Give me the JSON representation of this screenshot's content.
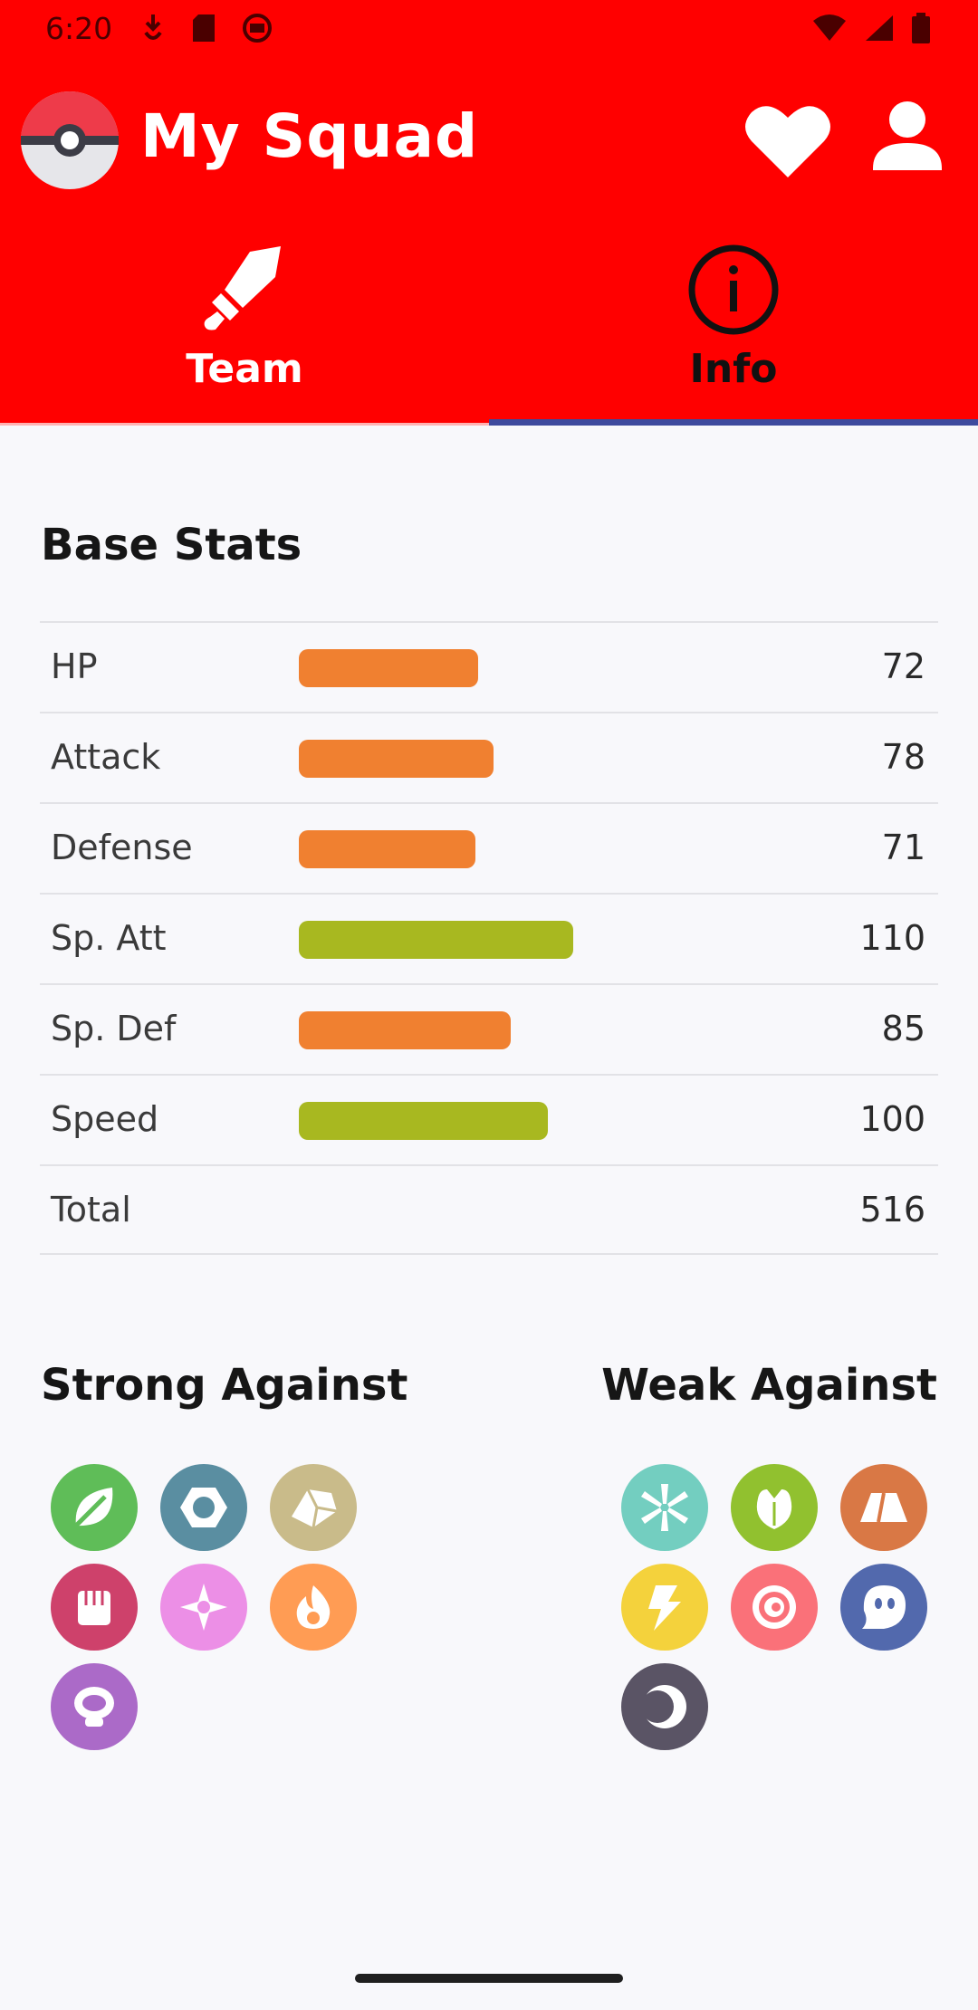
{
  "status_bar": {
    "time": "6:20"
  },
  "app_bar": {
    "title": "My Squad"
  },
  "tabs": [
    {
      "label": "Team",
      "icon": "sword-icon",
      "selected": false
    },
    {
      "label": "Info",
      "icon": "info-icon",
      "selected": true
    }
  ],
  "base_stats": {
    "title": "Base Stats",
    "max_value": 150,
    "rows": [
      {
        "name": "HP",
        "value": "72",
        "level": 72,
        "color": "#f08030"
      },
      {
        "name": "Attack",
        "value": "78",
        "level": 78,
        "color": "#f08030"
      },
      {
        "name": "Defense",
        "value": "71",
        "level": 71,
        "color": "#f08030"
      },
      {
        "name": "Sp. Att",
        "value": "110",
        "level": 110,
        "color": "#a8b820"
      },
      {
        "name": "Sp. Def",
        "value": "85",
        "level": 85,
        "color": "#f08030"
      },
      {
        "name": "Speed",
        "value": "100",
        "level": 100,
        "color": "#a8b820"
      }
    ],
    "total": {
      "name": "Total",
      "value": "516"
    }
  },
  "strong_against": {
    "title": "Strong Against",
    "types": [
      {
        "icon": "grass-type-icon",
        "color": "#5fbd58"
      },
      {
        "icon": "steel-type-icon",
        "color": "#5a8ea1"
      },
      {
        "icon": "rock-type-icon",
        "color": "#c9bb8a"
      },
      {
        "icon": "fighting-type-icon",
        "color": "#ce416b"
      },
      {
        "icon": "fairy-type-icon",
        "color": "#ec8fe6"
      },
      {
        "icon": "fire-type-icon",
        "color": "#ff9c54"
      },
      {
        "icon": "poison-type-icon",
        "color": "#ab6ac8"
      }
    ]
  },
  "weak_against": {
    "title": "Weak Against",
    "types": [
      {
        "icon": "ice-type-icon",
        "color": "#73cec0"
      },
      {
        "icon": "bug-type-icon",
        "color": "#91c12f"
      },
      {
        "icon": "ground-type-icon",
        "color": "#d97845"
      },
      {
        "icon": "electric-type-icon",
        "color": "#f4d23c"
      },
      {
        "icon": "psychic-type-icon",
        "color": "#fa7179"
      },
      {
        "icon": "ghost-type-icon",
        "color": "#5269ad"
      },
      {
        "icon": "dark-type-icon",
        "color": "#5a5465"
      }
    ]
  },
  "colors": {
    "header": "#ff0000",
    "tab_indicator": "#3e4a9e",
    "background": "#f8f8fb"
  }
}
